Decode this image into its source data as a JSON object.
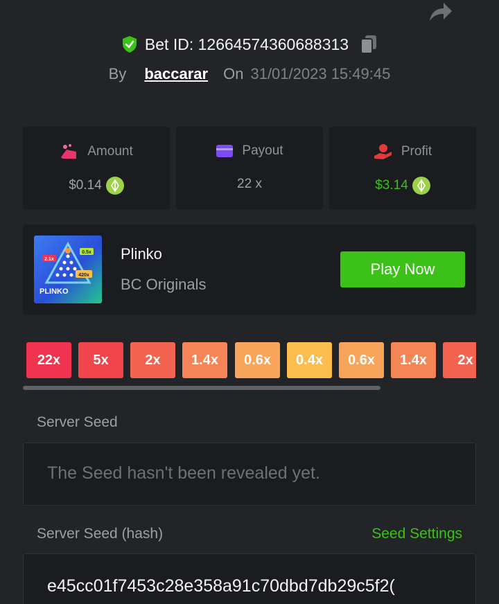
{
  "header": {
    "bet_id": "Bet ID: 12664574360688313",
    "by_label": "By",
    "username": "baccarar",
    "on_label": "On",
    "date": "31/01/2023 15:49:45"
  },
  "stats": {
    "amount": {
      "label": "Amount",
      "value": "$0.14"
    },
    "payout": {
      "label": "Payout",
      "value": "22 x"
    },
    "profit": {
      "label": "Profit",
      "value": "$3.14"
    }
  },
  "game": {
    "name": "Plinko",
    "provider": "BC Originals",
    "play_label": "Play Now",
    "thumb_title": "PLINKO",
    "thumb_tags": [
      "2.1x",
      "0.5x",
      "420x"
    ]
  },
  "multipliers": [
    {
      "label": "22x",
      "color": "#f0334f"
    },
    {
      "label": "5x",
      "color": "#f1454c"
    },
    {
      "label": "2x",
      "color": "#f26352"
    },
    {
      "label": "1.4x",
      "color": "#f58557"
    },
    {
      "label": "0.6x",
      "color": "#f8a45a"
    },
    {
      "label": "0.4x",
      "color": "#fbbd4d"
    },
    {
      "label": "0.6x",
      "color": "#f8a45a"
    },
    {
      "label": "1.4x",
      "color": "#f58557"
    },
    {
      "label": "2x",
      "color": "#f26352"
    }
  ],
  "server_seed": {
    "label": "Server Seed",
    "text": "The Seed hasn't been revealed yet."
  },
  "server_seed_hash": {
    "label": "Server Seed (hash)",
    "settings_label": "Seed Settings",
    "hash": "e45cc01f7453c28e358a91c70dbd7db29c5f2("
  },
  "icons": {
    "share": "share-icon",
    "shield": "shield-check-icon",
    "copy": "copy-icon",
    "amount": "bet-chips-icon",
    "payout": "wallet-card-icon",
    "profit": "hand-profit-icon",
    "coin": "eos-coin-icon"
  },
  "colors": {
    "accent_green": "#3bc117",
    "amount_icon": "#e8366b",
    "payout_icon": "#7b4cf0",
    "profit_icon": "#e23a3a",
    "coin": "#9ed14a"
  }
}
